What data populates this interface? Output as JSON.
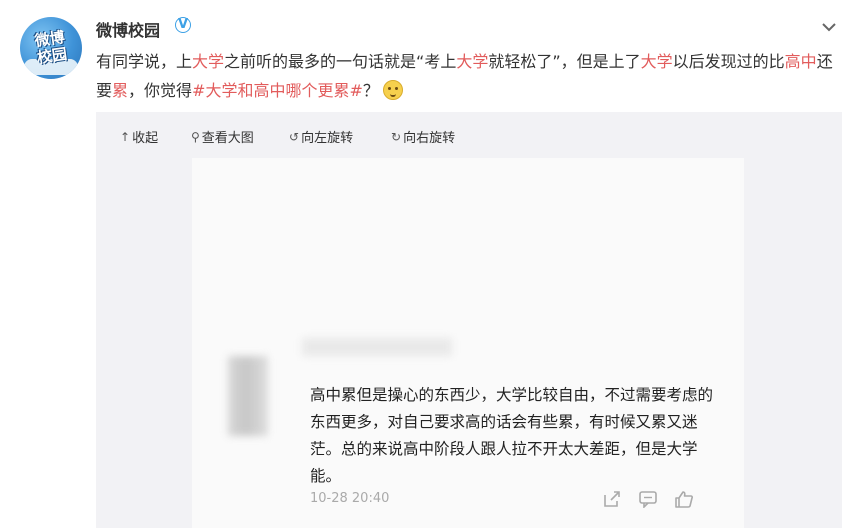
{
  "account": {
    "name": "微博校园",
    "avatar_text": "微博校园"
  },
  "post": {
    "segments": [
      {
        "text": "有同学说，上",
        "hl": false
      },
      {
        "text": "大学",
        "hl": true
      },
      {
        "text": "之前听的最多的一句话就是“考上",
        "hl": false
      },
      {
        "text": "大学",
        "hl": true
      },
      {
        "text": "就轻松了”，但是上了",
        "hl": false
      },
      {
        "text": "大学",
        "hl": true
      },
      {
        "text": "以后发现过的比",
        "hl": false
      },
      {
        "text": "高中",
        "hl": true
      },
      {
        "text": "还要",
        "hl": false
      },
      {
        "text": "累",
        "hl": true
      },
      {
        "text": "，你觉得",
        "hl": false
      },
      {
        "text": "#大学和高中哪个更累#",
        "hl": true
      },
      {
        "text": "？",
        "hl": false
      }
    ],
    "emoji": "doge-emoji"
  },
  "media_toolbar": {
    "collapse": "收起",
    "view_large": "查看大图",
    "rotate_left": "向左旋转",
    "rotate_right": "向右旋转"
  },
  "screenshot_comment": {
    "text": "高中累但是操心的东西少，大学比较自由，不过需要考虑的东西更多，对自己要求高的话会有些累，有时候又累又迷茫。总的来说高中阶段人跟人拉不开太大差距，但是大学能。",
    "time": "10-28 20:40",
    "actions": [
      "share-icon",
      "comment-icon",
      "like-icon"
    ]
  },
  "colors": {
    "highlight": "#e25c5c",
    "verified": "#3da1e6",
    "media_bg": "#f2f2f5"
  }
}
